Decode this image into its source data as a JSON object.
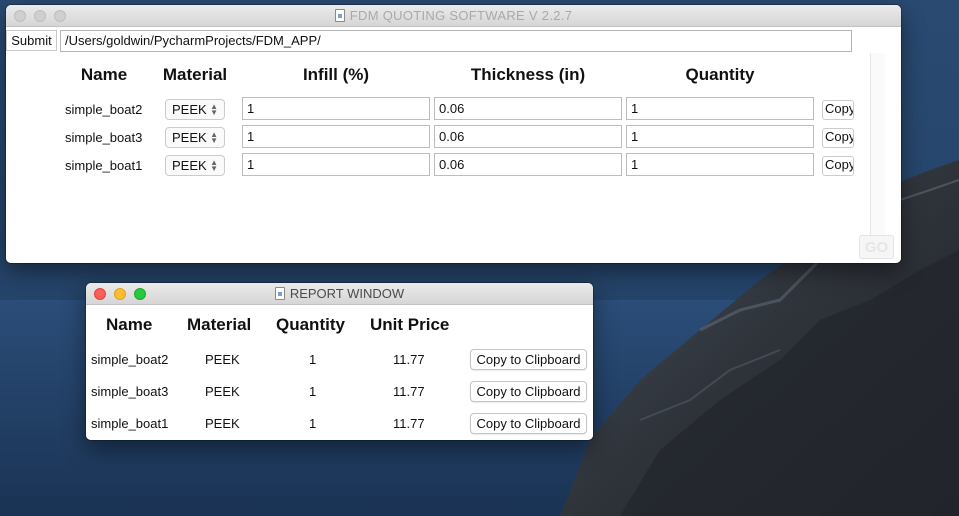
{
  "main_window": {
    "title": "FDM QUOTING SOFTWARE V 2.2.7",
    "submit_label": "Submit",
    "path_value": "/Users/goldwin/PycharmProjects/FDM_APP/",
    "headers": {
      "name": "Name",
      "material": "Material",
      "infill": "Infill (%)",
      "thickness": "Thickness (in)",
      "quantity": "Quantity"
    },
    "rows": [
      {
        "name": "simple_boat2",
        "material": "PEEK",
        "infill": "1",
        "thickness": "0.06",
        "quantity": "1",
        "copy": "Copy"
      },
      {
        "name": "simple_boat3",
        "material": "PEEK",
        "infill": "1",
        "thickness": "0.06",
        "quantity": "1",
        "copy": "Copy"
      },
      {
        "name": "simple_boat1",
        "material": "PEEK",
        "infill": "1",
        "thickness": "0.06",
        "quantity": "1",
        "copy": "Copy"
      }
    ],
    "go_label": "GO"
  },
  "report_window": {
    "title": "REPORT WINDOW",
    "headers": {
      "name": "Name",
      "material": "Material",
      "quantity": "Quantity",
      "unit_price": "Unit Price"
    },
    "rows": [
      {
        "name": "simple_boat2",
        "material": "PEEK",
        "quantity": "1",
        "unit_price": "11.77",
        "copy": "Copy to Clipboard"
      },
      {
        "name": "simple_boat3",
        "material": "PEEK",
        "quantity": "1",
        "unit_price": "11.77",
        "copy": "Copy to Clipboard"
      },
      {
        "name": "simple_boat1",
        "material": "PEEK",
        "quantity": "1",
        "unit_price": "11.77",
        "copy": "Copy to Clipboard"
      }
    ]
  },
  "icons": {
    "window_icon": "document-icon",
    "select_icon": "chevron-updown-icon"
  },
  "colors": {
    "close": "#fe5f57",
    "minimize": "#febc2e",
    "zoom": "#28c840",
    "inactive_light": "#cfcfcf"
  }
}
